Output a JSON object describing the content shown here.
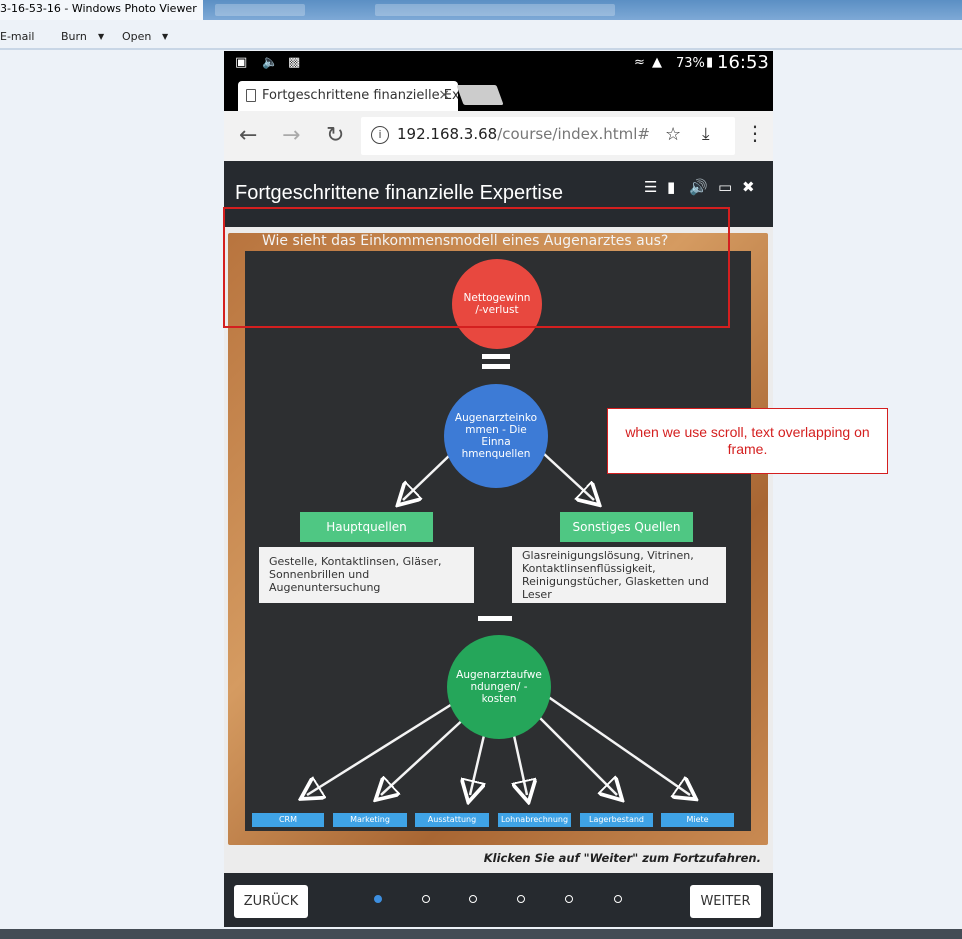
{
  "window": {
    "title": "3-16-53-16 - Windows Photo Viewer"
  },
  "menu": {
    "email": "E-mail",
    "burn": "Burn",
    "open": "Open",
    "arrow": "▼"
  },
  "phone": {
    "status": {
      "battery": "73%",
      "time": "16:53"
    },
    "tab": {
      "title": "Fortgeschrittene finanzielle Expertise",
      "close": "×"
    },
    "address": {
      "host": "192.168.3.68",
      "path": "/course/index.html#"
    },
    "course": {
      "title": "Fortgeschrittene finanzielle Expertise"
    },
    "slide": {
      "question": "Wie sieht das Einkommensmodell eines Augenarztes aus?",
      "profit": "Nettogewinn /-verlust",
      "income": "Augenarzteinko mmen - Die Einna hmenquellen",
      "main_sources": "Hauptquellen",
      "other_sources": "Sonstiges Quellen",
      "main_sources_text": "Gestelle, Kontaktlinsen, Gläser, Sonnenbrillen und Augenuntersuchung",
      "other_sources_text": "Glasreinigungslösung, Vitrinen, Kontaktlinsenflüssigkeit, Reinigungstücher, Glasketten und Leser",
      "expenses": "Augenarztaufwe ndungen/ -kosten",
      "costs": [
        "CRM",
        "Marketing",
        "Ausstattung",
        "Lohnabrechnung",
        "Lagerbestand",
        "Miete"
      ]
    },
    "hint": "Klicken Sie auf \"Weiter\" zum Fortzufahren.",
    "footer": {
      "back": "ZURÜCK",
      "next": "WEITER",
      "pages": 6,
      "current_page": 1
    }
  },
  "annotation": {
    "callout": "when we use scroll, text overlapping on frame."
  },
  "colors": {
    "red": "#e8483f",
    "blue": "#3d7bd6",
    "green": "#25a65a",
    "source_green": "#4fc783",
    "cost_blue": "#3fa3e6",
    "highlight": "#d41f1f"
  }
}
